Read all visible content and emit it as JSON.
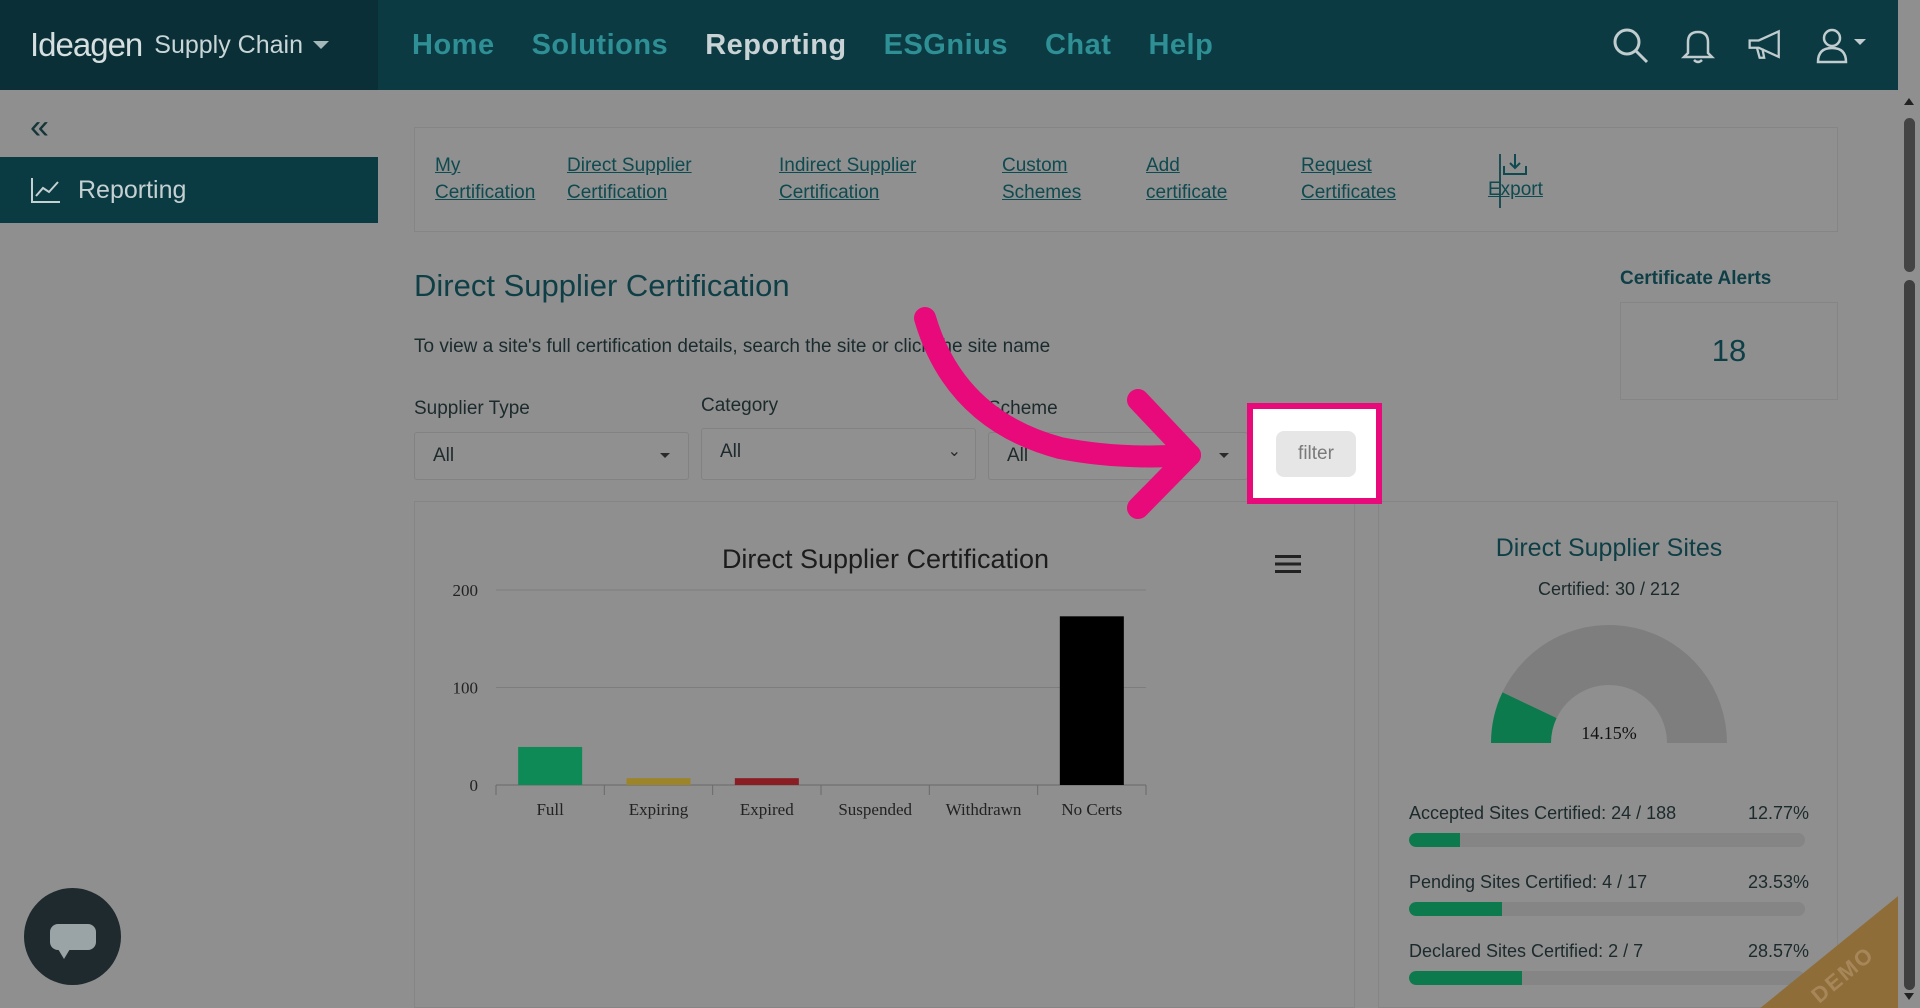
{
  "brand": {
    "logo": "Ideagen",
    "product": "Supply Chain"
  },
  "nav": {
    "items": [
      {
        "label": "Home",
        "active": false
      },
      {
        "label": "Solutions",
        "active": false
      },
      {
        "label": "Reporting",
        "active": true
      },
      {
        "label": "ESGnius",
        "active": false
      },
      {
        "label": "Chat",
        "active": false
      },
      {
        "label": "Help",
        "active": false
      }
    ]
  },
  "top_icons": [
    "search-icon",
    "bell-icon",
    "megaphone-icon",
    "user-icon"
  ],
  "sidebar": {
    "collapse_icon": "double-chevron-left-icon",
    "items": [
      {
        "label": "Reporting",
        "icon": "chart-line-icon"
      }
    ]
  },
  "tabs": [
    {
      "line1": "My",
      "line2": "Certification"
    },
    {
      "line1": "Direct Supplier",
      "line2": "Certification"
    },
    {
      "line1": "Indirect Supplier",
      "line2": "Certification"
    },
    {
      "line1": "Custom",
      "line2": "Schemes"
    },
    {
      "line1": "Add",
      "line2": "certificate"
    },
    {
      "line1": "Request",
      "line2": "Certificates"
    },
    {
      "line1": "",
      "line2": "Export"
    }
  ],
  "page": {
    "title": "Direct Supplier Certification",
    "description": "To view a site's full certification details, search the site or click the site name"
  },
  "alerts": {
    "title": "Certificate Alerts",
    "count": "18"
  },
  "filters": {
    "supplier_type": {
      "label": "Supplier Type",
      "value": "All"
    },
    "category": {
      "label": "Category",
      "value": "All"
    },
    "scheme": {
      "label": "Scheme",
      "value": "All"
    },
    "filter_button": "filter"
  },
  "chart_data": {
    "type": "bar",
    "title": "Direct Supplier Certification",
    "categories": [
      "Full",
      "Expiring",
      "Expired",
      "Suspended",
      "Withdrawn",
      "No Certs"
    ],
    "values": [
      39,
      7,
      7,
      0,
      0,
      173
    ],
    "colors": [
      "#0d8a55",
      "#9c8428",
      "#8a1c24",
      "#888888",
      "#888888",
      "#000000"
    ],
    "ylim": [
      0,
      200
    ],
    "yticks": [
      "0",
      "100",
      "200"
    ],
    "grid": true
  },
  "sites": {
    "title": "Direct Supplier Sites",
    "certified": "Certified: 30 / 212",
    "gauge_value": 14.15,
    "gauge_label": "14.15%",
    "rows": [
      {
        "label": "Accepted Sites Certified: 24 / 188",
        "pct": "12.77%",
        "fraction": 0.1277
      },
      {
        "label": "Pending Sites Certified: 4 / 17",
        "pct": "23.53%",
        "fraction": 0.2353
      },
      {
        "label": "Declared Sites Certified: 2 / 7",
        "pct": "28.57%",
        "fraction": 0.2857
      }
    ]
  },
  "demo_ribbon": "DEMO",
  "colors": {
    "accent": "#0b3a42",
    "highlight": "#e8097a",
    "link": "#0e4a4f"
  }
}
